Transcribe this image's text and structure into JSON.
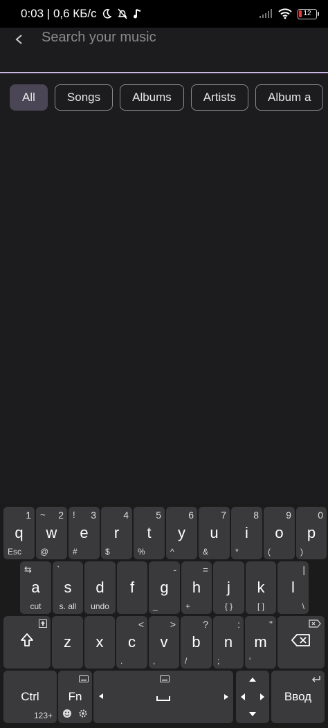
{
  "status_bar": {
    "time_speed": "0:03 | 0,6 КБ/с",
    "battery_level": "12"
  },
  "search": {
    "placeholder": "Search your music"
  },
  "chips": [
    {
      "label": "All",
      "active": true
    },
    {
      "label": "Songs",
      "active": false
    },
    {
      "label": "Albums",
      "active": false
    },
    {
      "label": "Artists",
      "active": false
    },
    {
      "label": "Album a",
      "active": false
    }
  ],
  "keyboard": {
    "row1": [
      {
        "main": "q",
        "hint": "1",
        "sub": "Esc"
      },
      {
        "main": "w",
        "hint": "2",
        "hint_left": "~",
        "sub": "@"
      },
      {
        "main": "e",
        "hint": "3",
        "hint_left": "!",
        "sub": "#"
      },
      {
        "main": "r",
        "hint": "4",
        "sub": "$"
      },
      {
        "main": "t",
        "hint": "5",
        "sub": "%"
      },
      {
        "main": "y",
        "hint": "6",
        "sub": "^"
      },
      {
        "main": "u",
        "hint": "7",
        "sub": "&"
      },
      {
        "main": "i",
        "hint": "8",
        "sub": "*"
      },
      {
        "main": "o",
        "hint": "9",
        "sub": "("
      },
      {
        "main": "p",
        "hint": "0",
        "sub": ")"
      }
    ],
    "row2": [
      {
        "main": "a",
        "sub": "cut",
        "hint_left": "⇆"
      },
      {
        "main": "s",
        "sub": "s. all",
        "hint_left": "`"
      },
      {
        "main": "d",
        "sub": "undo"
      },
      {
        "main": "f",
        "sub": ""
      },
      {
        "main": "g",
        "sub": "_",
        "hint": "-"
      },
      {
        "main": "h",
        "sub": "+",
        "hint": "="
      },
      {
        "main": "j",
        "sub": "{    }"
      },
      {
        "main": "k",
        "sub": "[    ]"
      },
      {
        "main": "l",
        "sub": "\\",
        "hint": "|"
      }
    ],
    "row3": [
      {
        "main": "z",
        "hint": ""
      },
      {
        "main": "x",
        "hint": ""
      },
      {
        "main": "c",
        "hint": "<",
        "sub": "."
      },
      {
        "main": "v",
        "hint": ">",
        "sub": ","
      },
      {
        "main": "b",
        "hint": "?",
        "sub": "/"
      },
      {
        "main": "n",
        "hint": ":",
        "sub": ";"
      },
      {
        "main": "m",
        "hint": "\"",
        "sub": "'"
      }
    ],
    "ctrl_label": "Ctrl",
    "fn_label": "Fn",
    "num_label": "123+",
    "enter_label": "Ввод"
  }
}
